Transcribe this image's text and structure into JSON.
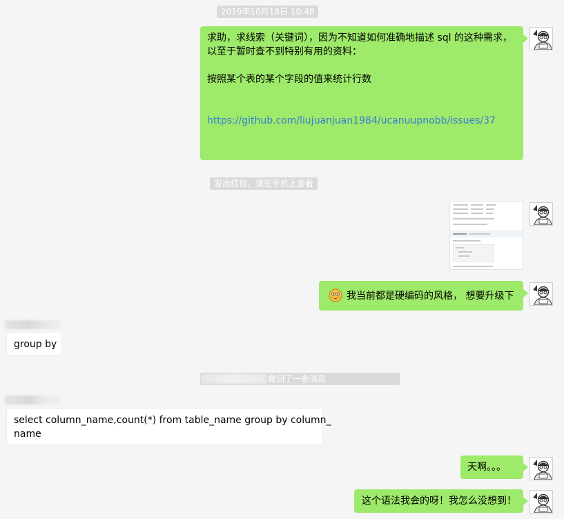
{
  "notices": {
    "timestamp": "2019年10月18日 10:48",
    "red_packet": "发出红包，请在手机上查看",
    "recalled_suffix": "撤回了一条消息"
  },
  "messages": {
    "m1": {
      "line1": "求助，求线索（关键词），因为不知道如何准确地描述 sql 的这种需求，",
      "line2": "以至于暂时查不到特别有用的资料：",
      "line3": "按照某个表的某个字段的值来统计行数",
      "link": "https://github.com/liujuanjuan1984/ucanuupnobb/issues/37"
    },
    "m3": {
      "text": "我当前都是硬编码的风格， 想要升级下"
    },
    "m4": {
      "text": "group by"
    },
    "m5": {
      "line1": "select column_name,count(*) from table_name group by column_",
      "line2": "name"
    },
    "m6": {
      "text": "天啊。。。"
    },
    "m7": {
      "text": "这个语法我会的呀！我怎么没想到！"
    }
  },
  "colors": {
    "my_bubble": "#9eea6a",
    "their_bubble": "#ffffff",
    "notice": "#dadada",
    "background": "#f5f5f5",
    "link": "#3a7bd5"
  },
  "icons": {
    "avatar": "cartoon-girl-with-glasses-avatar",
    "emoji": "flushed-face-emoji"
  }
}
